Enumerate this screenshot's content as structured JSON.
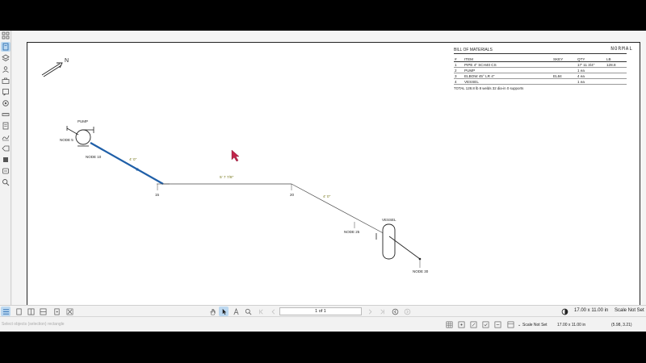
{
  "mode_label": "NORMAL",
  "north_label": "N",
  "bom": {
    "title": "BILL OF MATERIALS",
    "columns": [
      "#",
      "ITEM",
      "SKEY",
      "QTY",
      "LB"
    ],
    "rows": [
      [
        "1",
        "PIPE 4\" SCH40 CS",
        "",
        "17' 11 3/4\"",
        "128.8"
      ],
      [
        "2",
        "PUMP",
        "",
        "1 ea",
        ""
      ],
      [
        "3",
        "ELBOW 45° LR 4\"",
        "EL84",
        "4 ea",
        ""
      ],
      [
        "4",
        "VESSEL",
        "",
        "1 ea",
        ""
      ]
    ],
    "total": "TOTAL 128.8 lb   8 welds   32 dia-in   0 supports"
  },
  "drawing": {
    "labels": {
      "pump": "PUMP",
      "node5": "NODE 5",
      "node10": "NODE 10",
      "dim1": "4' 0\"",
      "n15": "15",
      "dim2": "5' 7 7/8\"",
      "n20": "20",
      "dim3": "4' 0\"",
      "vessel": "VESSEL",
      "node25": "NODE 25",
      "node30": "NODE 30"
    },
    "colors": {
      "selected_pipe": "#1f5fa8",
      "pipe": "#444444",
      "dimension": "#7a7a20"
    }
  },
  "bottom_bar": {
    "page": "1 of 1",
    "page_size": "17.00 x 11.00 in",
    "scale": "Scale Not Set"
  },
  "status_bar": {
    "message": "Select objects (selection) rectangle",
    "scale": "Scale Not Set",
    "page_size": "17.00 x 11.00 in",
    "coords": "(5.98, 3.21)"
  }
}
